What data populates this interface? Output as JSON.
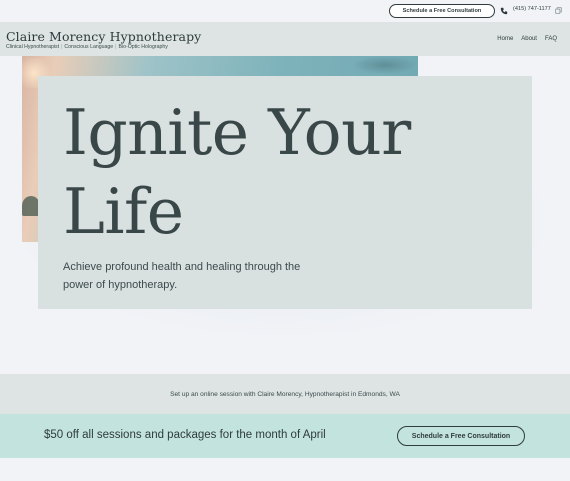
{
  "topbar": {
    "consult_label": "Schedule a Free Consultation",
    "phone": "(415) 747-1177",
    "phone_icon": "phone-icon",
    "copy_icon": "copy-icon"
  },
  "header": {
    "title": "Claire Morency Hypnotherapy",
    "subtitles": [
      "Clinical Hypnotherapist",
      "Conscious Language",
      "Bio-Optic Holography"
    ],
    "nav": [
      "Home",
      "About",
      "FAQ"
    ]
  },
  "hero": {
    "title": "Ignite Your Life",
    "tagline": "Achieve profound health and healing through the power of hypnotherapy."
  },
  "session_strip": {
    "text": "Set up an online session with Claire Morency, Hypnotherapist in Edmonds, WA"
  },
  "promo": {
    "text": "$50 off all sessions and packages for the month of April",
    "consult_label": "Schedule a Free Consultation"
  },
  "colors": {
    "header_bg": "#dde4e3",
    "card_bg": "#d9e1e0",
    "promo_bg": "#c3e3df",
    "text_dark": "#2f3b3d"
  }
}
